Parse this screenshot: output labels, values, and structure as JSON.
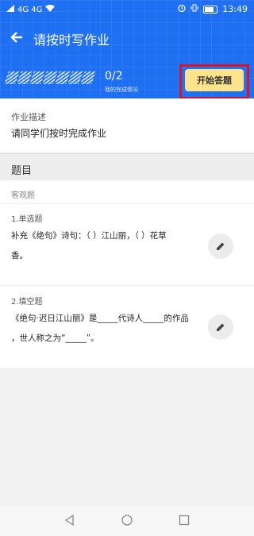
{
  "status_bar": {
    "carrier": "4G 4G",
    "time": "13:49"
  },
  "header": {
    "title": "请按时写作业",
    "progress_count": "0/2",
    "progress_caption": "我的完成情况",
    "start_button_label": "开始答题"
  },
  "description": {
    "label": "作业描述",
    "text": "请同学们按时完成作业"
  },
  "section": {
    "title": "题目",
    "subtype": "客观题"
  },
  "questions": [
    {
      "type": "1.单选题",
      "line1": "补充《绝句》诗句：（    ）江山丽，（    ）花草",
      "line2": "香。"
    },
    {
      "type": "2.填空题",
      "line1": "《绝句·迟日江山丽》是_____代诗人_____的作品",
      "line2": "，世人称之为“_____”。"
    }
  ],
  "colors": {
    "header_blue": "#1e6ff2",
    "start_button": "#fde38b",
    "highlight_border": "#d3162a"
  }
}
